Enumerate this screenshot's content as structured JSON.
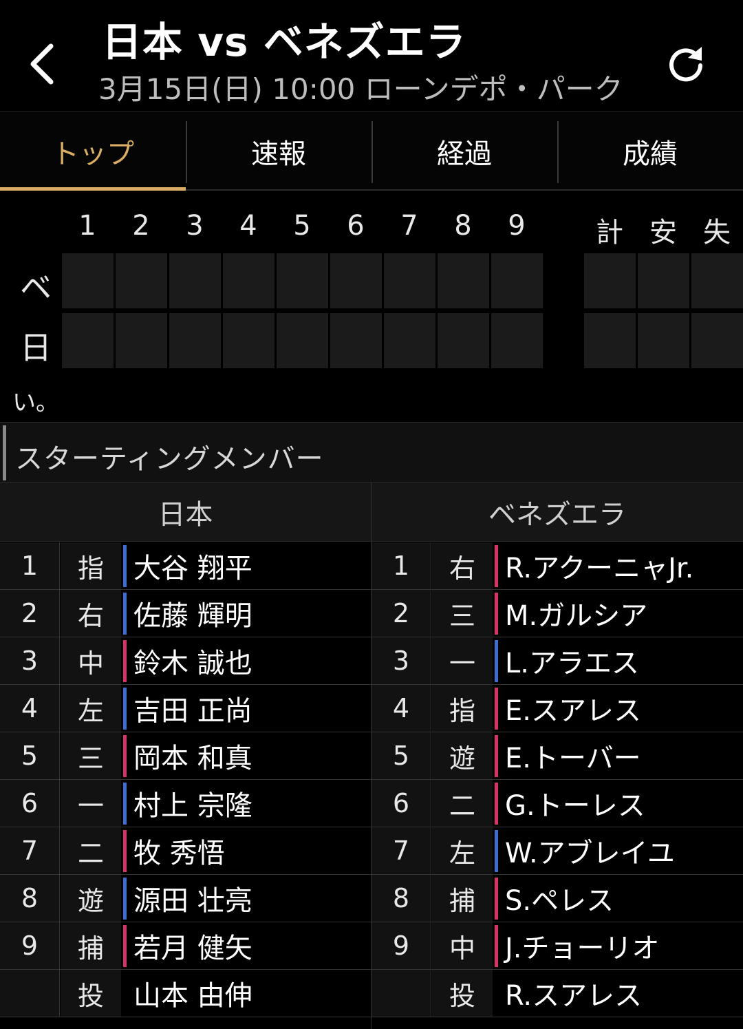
{
  "header": {
    "title": "日本 vs ベネズエラ",
    "subtitle": "3月15日(日) 10:00 ローンデポ・パーク"
  },
  "tabs": [
    {
      "label": "トップ",
      "active": true
    },
    {
      "label": "速報",
      "active": false
    },
    {
      "label": "経過",
      "active": false
    },
    {
      "label": "成績",
      "active": false
    }
  ],
  "scoreboard": {
    "innings": [
      "1",
      "2",
      "3",
      "4",
      "5",
      "6",
      "7",
      "8",
      "9"
    ],
    "totals_headers": [
      "計",
      "安",
      "失"
    ],
    "rows": [
      {
        "team_abbr": "ベ"
      },
      {
        "team_abbr": "日"
      }
    ],
    "truncated_note": "い。"
  },
  "starting_members": {
    "section_title": "スターティングメンバー",
    "home": {
      "team_name": "日本",
      "lineup": [
        {
          "order": "1",
          "pos": "指",
          "name": "大谷 翔平",
          "bats": "L"
        },
        {
          "order": "2",
          "pos": "右",
          "name": "佐藤 輝明",
          "bats": "L"
        },
        {
          "order": "3",
          "pos": "中",
          "name": "鈴木 誠也",
          "bats": "R"
        },
        {
          "order": "4",
          "pos": "左",
          "name": "吉田 正尚",
          "bats": "L"
        },
        {
          "order": "5",
          "pos": "三",
          "name": "岡本 和真",
          "bats": "R"
        },
        {
          "order": "6",
          "pos": "一",
          "name": "村上 宗隆",
          "bats": "L"
        },
        {
          "order": "7",
          "pos": "二",
          "name": "牧 秀悟",
          "bats": "R"
        },
        {
          "order": "8",
          "pos": "遊",
          "name": "源田 壮亮",
          "bats": "L"
        },
        {
          "order": "9",
          "pos": "捕",
          "name": "若月 健矢",
          "bats": "R"
        },
        {
          "order": "",
          "pos": "投",
          "name": "山本 由伸",
          "bats": ""
        }
      ]
    },
    "away": {
      "team_name": "ベネズエラ",
      "lineup": [
        {
          "order": "1",
          "pos": "右",
          "name": "R.アクーニャJr.",
          "bats": "R"
        },
        {
          "order": "2",
          "pos": "三",
          "name": "M.ガルシア",
          "bats": "R"
        },
        {
          "order": "3",
          "pos": "一",
          "name": "L.アラエス",
          "bats": "L"
        },
        {
          "order": "4",
          "pos": "指",
          "name": "E.スアレス",
          "bats": "R"
        },
        {
          "order": "5",
          "pos": "遊",
          "name": "E.トーバー",
          "bats": "R"
        },
        {
          "order": "6",
          "pos": "二",
          "name": "G.トーレス",
          "bats": "R"
        },
        {
          "order": "7",
          "pos": "左",
          "name": "W.アブレイユ",
          "bats": "L"
        },
        {
          "order": "8",
          "pos": "捕",
          "name": "S.ペレス",
          "bats": "R"
        },
        {
          "order": "9",
          "pos": "中",
          "name": "J.チョーリオ",
          "bats": "R"
        },
        {
          "order": "",
          "pos": "投",
          "name": "R.スアレス",
          "bats": ""
        }
      ]
    }
  },
  "colors": {
    "accent": "#d9ad63",
    "bats_left": "#3d6fd1",
    "bats_right": "#d6336c"
  }
}
